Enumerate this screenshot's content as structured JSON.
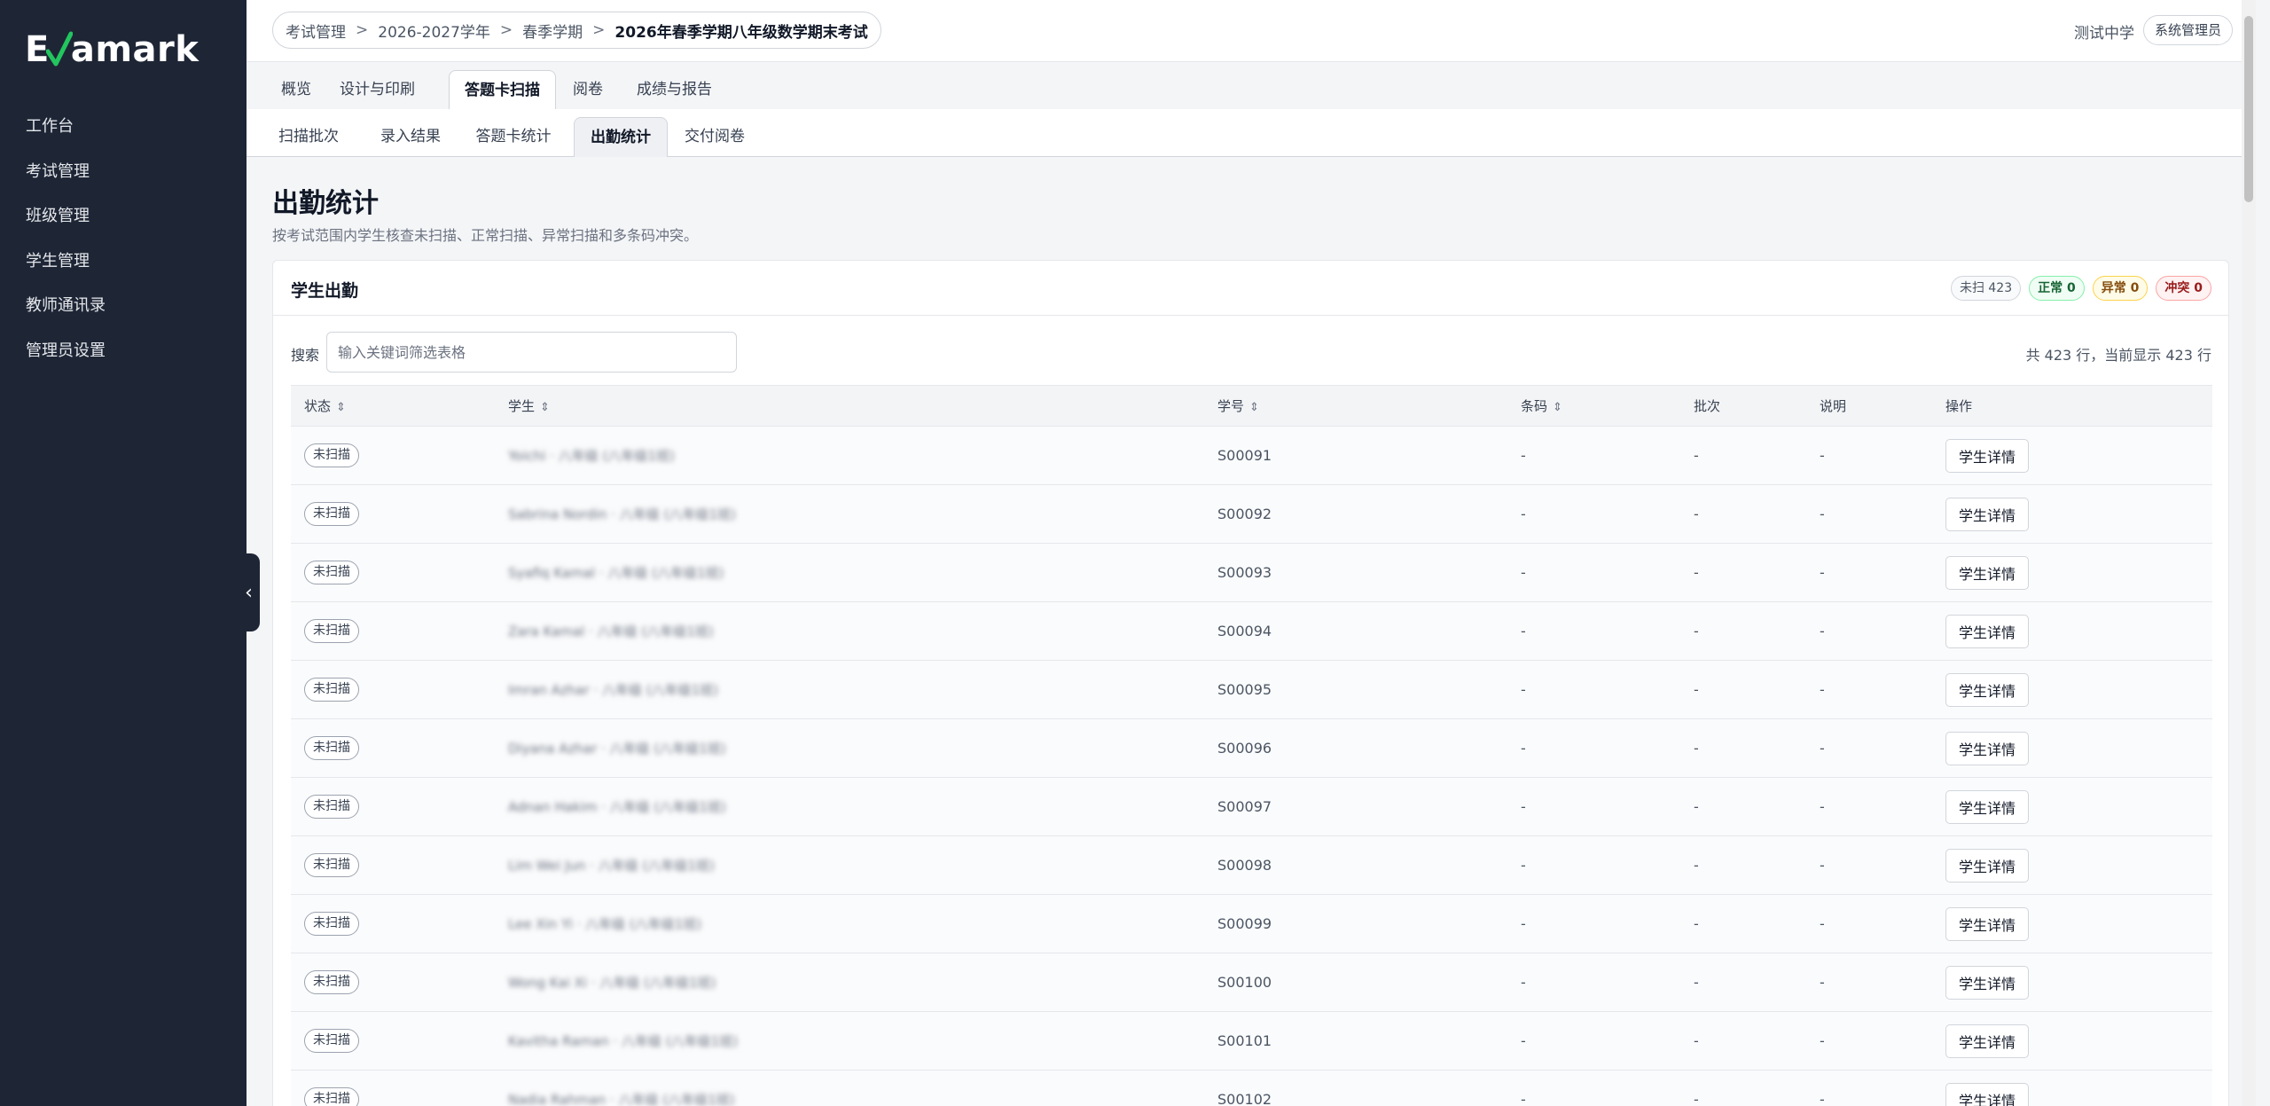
{
  "app": {
    "logo_text_1": "E",
    "logo_text_2": "amark"
  },
  "sidebar": {
    "items": [
      {
        "label": "工作台"
      },
      {
        "label": "考试管理"
      },
      {
        "label": "班级管理"
      },
      {
        "label": "学生管理"
      },
      {
        "label": "教师通讯录"
      },
      {
        "label": "管理员设置"
      }
    ],
    "collapse_icon": "‹"
  },
  "header": {
    "breadcrumb": [
      "考试管理",
      "2026-2027学年",
      "春季学期",
      "2026年春季学期八年级数学期末考试"
    ],
    "breadcrumb_sep": ">",
    "school": "测试中学",
    "role": "系统管理员"
  },
  "tabs_primary": [
    {
      "label": "概览"
    },
    {
      "label": "设计与印刷"
    },
    {
      "label": "答题卡扫描",
      "active": true
    },
    {
      "label": "阅卷"
    },
    {
      "label": "成绩与报告"
    }
  ],
  "tabs_secondary": [
    {
      "label": "扫描批次"
    },
    {
      "label": "录入结果"
    },
    {
      "label": "答题卡统计"
    },
    {
      "label": "出勤统计",
      "active": true
    },
    {
      "label": "交付阅卷"
    }
  ],
  "page": {
    "title": "出勤统计",
    "subtitle": "按考试范围内学生核查未扫描、正常扫描、异常扫描和多条码冲突。"
  },
  "card": {
    "title": "学生出勤",
    "badges": {
      "unscanned": "未扫 423",
      "normal": "正常 0",
      "abnormal": "异常 0",
      "conflict": "冲突 0"
    },
    "search": {
      "label": "搜索",
      "placeholder": "输入关键词筛选表格",
      "value": ""
    },
    "row_count": "共 423 行，当前显示 423 行"
  },
  "table": {
    "columns": {
      "status": "状态",
      "student": "学生",
      "number": "学号",
      "barcode": "条码",
      "batch": "批次",
      "note": "说明",
      "action": "操作"
    },
    "sort_icon": "⇕",
    "rows": [
      {
        "status": "未扫描",
        "student": "Yoichi · 八年级 (八年级1班)",
        "number": "S00091",
        "barcode": "-",
        "batch": "-",
        "note": "-",
        "action": "学生详情"
      },
      {
        "status": "未扫描",
        "student": "Sabrina Nordin · 八年级 (八年级1班)",
        "number": "S00092",
        "barcode": "-",
        "batch": "-",
        "note": "-",
        "action": "学生详情"
      },
      {
        "status": "未扫描",
        "student": "Syafiq Kamal · 八年级 (八年级1班)",
        "number": "S00093",
        "barcode": "-",
        "batch": "-",
        "note": "-",
        "action": "学生详情"
      },
      {
        "status": "未扫描",
        "student": "Zara Kamal · 八年级 (八年级1班)",
        "number": "S00094",
        "barcode": "-",
        "batch": "-",
        "note": "-",
        "action": "学生详情"
      },
      {
        "status": "未扫描",
        "student": "Imran Azhar · 八年级 (八年级1班)",
        "number": "S00095",
        "barcode": "-",
        "batch": "-",
        "note": "-",
        "action": "学生详情"
      },
      {
        "status": "未扫描",
        "student": "Diyana Azhar · 八年级 (八年级1班)",
        "number": "S00096",
        "barcode": "-",
        "batch": "-",
        "note": "-",
        "action": "学生详情"
      },
      {
        "status": "未扫描",
        "student": "Adnan Hakim · 八年级 (八年级1班)",
        "number": "S00097",
        "barcode": "-",
        "batch": "-",
        "note": "-",
        "action": "学生详情"
      },
      {
        "status": "未扫描",
        "student": "Lim Wei Jun · 八年级 (八年级1班)",
        "number": "S00098",
        "barcode": "-",
        "batch": "-",
        "note": "-",
        "action": "学生详情"
      },
      {
        "status": "未扫描",
        "student": "Lee Xin Yi · 八年级 (八年级1班)",
        "number": "S00099",
        "barcode": "-",
        "batch": "-",
        "note": "-",
        "action": "学生详情"
      },
      {
        "status": "未扫描",
        "student": "Wong Kai Xi · 八年级 (八年级1班)",
        "number": "S00100",
        "barcode": "-",
        "batch": "-",
        "note": "-",
        "action": "学生详情"
      },
      {
        "status": "未扫描",
        "student": "Kavitha Raman · 八年级 (八年级1班)",
        "number": "S00101",
        "barcode": "-",
        "batch": "-",
        "note": "-",
        "action": "学生详情"
      },
      {
        "status": "未扫描",
        "student": "Nadia Rahman · 八年级 (八年级1班)",
        "number": "S00102",
        "barcode": "-",
        "batch": "-",
        "note": "-",
        "action": "学生详情"
      }
    ]
  }
}
